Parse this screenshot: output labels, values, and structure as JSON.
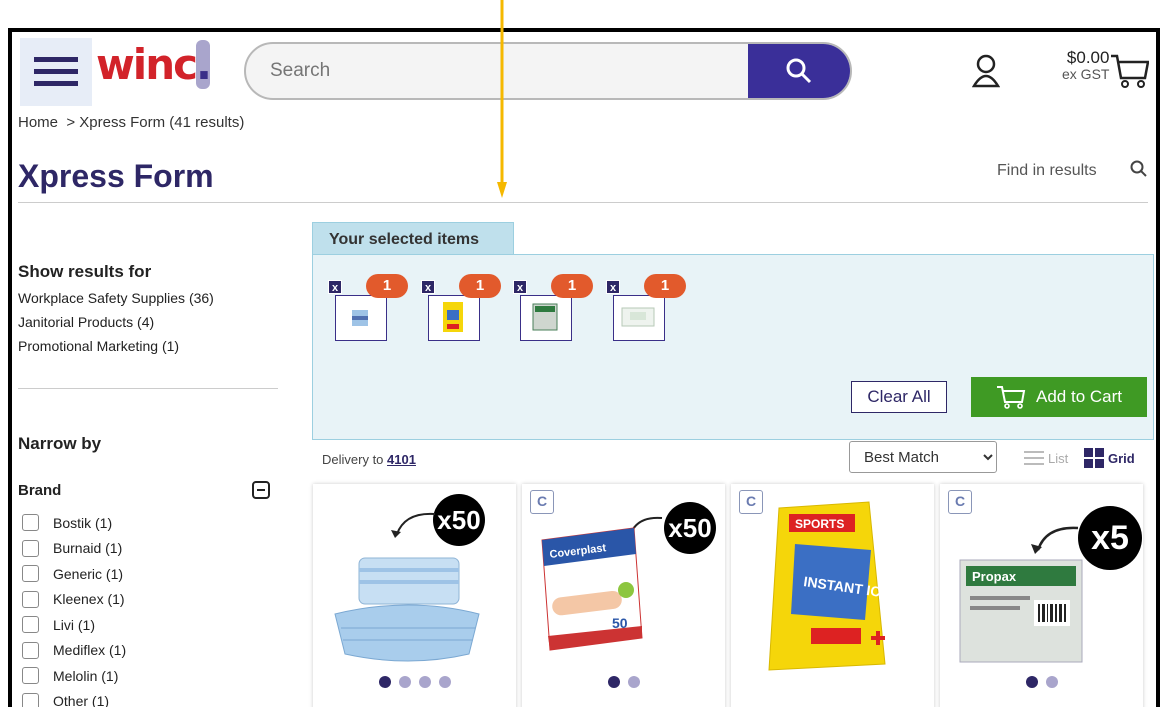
{
  "header": {
    "logo_text": "winc",
    "logo_dot": ".",
    "search_placeholder": "Search",
    "cart_amount": "$0.00",
    "cart_tax": "ex GST"
  },
  "breadcrumb": {
    "home": "Home",
    "separator": ">",
    "current": "Xpress Form (41 results)"
  },
  "page_title": "Xpress Form",
  "find_in_results": "Find in results",
  "sidebar": {
    "show_results_heading": "Show results for",
    "categories": [
      "Workplace Safety Supplies (36)",
      "Janitorial Products (4)",
      "Promotional Marketing (1)"
    ],
    "narrow_heading": "Narrow by",
    "brand_heading": "Brand",
    "brands": [
      "Bostik (1)",
      "Burnaid (1)",
      "Generic (1)",
      "Kleenex (1)",
      "Livi (1)",
      "Mediflex (1)",
      "Melolin (1)",
      "Other (1)"
    ]
  },
  "selected": {
    "tab_label": "Your selected items",
    "remove_glyph": "x",
    "items": [
      {
        "qty": "1"
      },
      {
        "qty": "1"
      },
      {
        "qty": "1"
      },
      {
        "qty": "1"
      }
    ],
    "clear_label": "Clear All",
    "add_label": "Add to Cart"
  },
  "toolbar": {
    "delivery_label": "Delivery to",
    "delivery_postcode": "4101",
    "sort_selected": "Best Match",
    "list_label": "List",
    "grid_label": "Grid"
  },
  "products": [
    {
      "badge": "",
      "multiplier": "x50"
    },
    {
      "badge": "C",
      "multiplier": "x50",
      "brand_print": "Coverplast",
      "count_print": "50"
    },
    {
      "badge": "C",
      "multiplier": "",
      "brand_print": "SPORTS",
      "product_print": "INSTANT ICE"
    },
    {
      "badge": "C",
      "multiplier": "x5",
      "brand_print": "Propax"
    }
  ],
  "colors": {
    "brand_purple": "#2e2766",
    "brand_red": "#d2232a",
    "add_green": "#3f9a24",
    "qty_orange": "#e25a2c",
    "arrow": "#f5b800"
  }
}
